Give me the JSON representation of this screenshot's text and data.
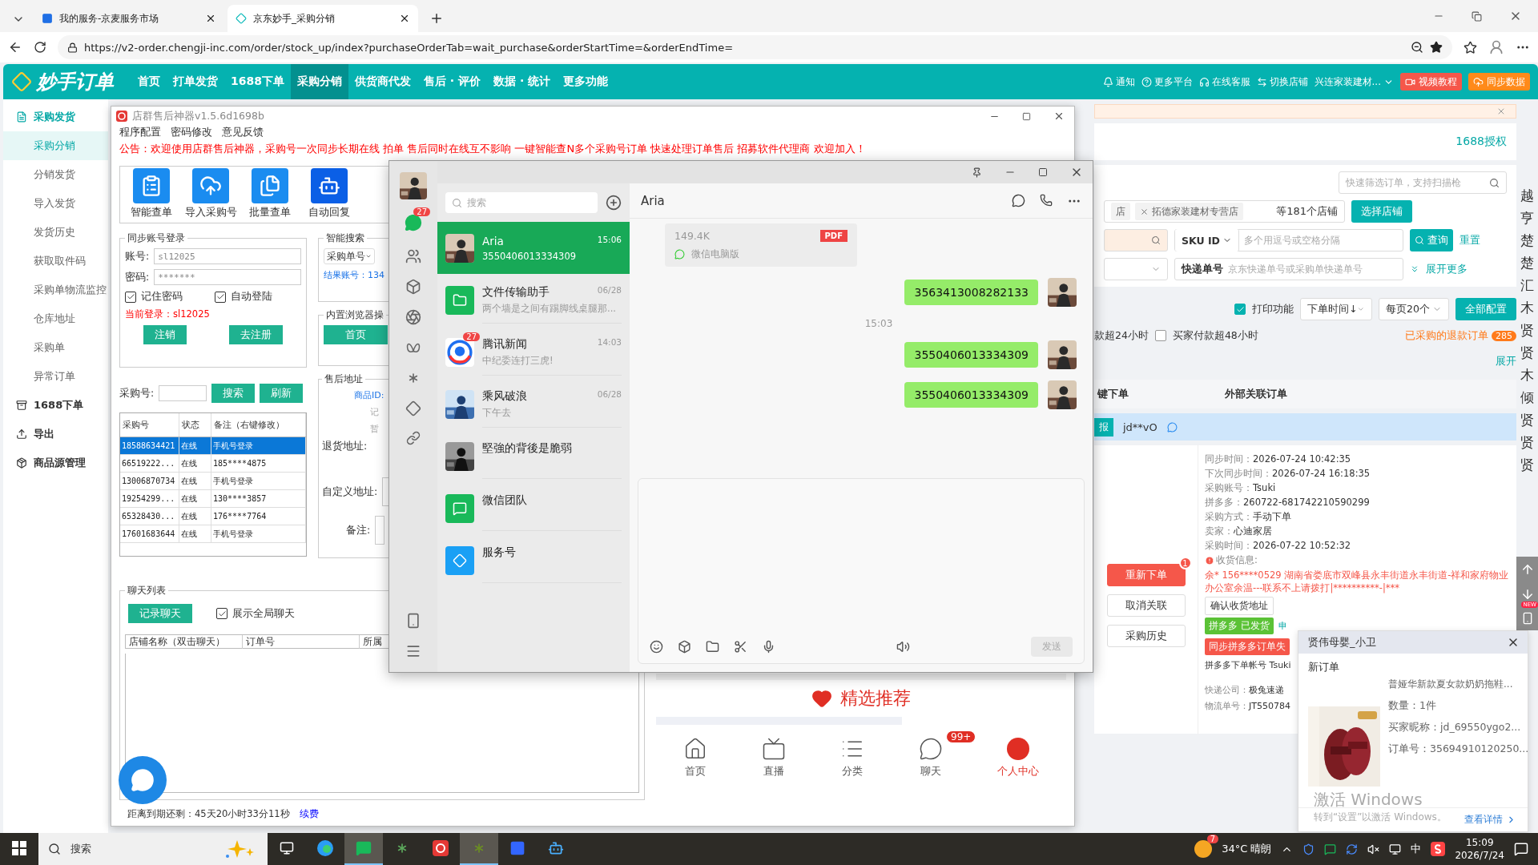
{
  "browser": {
    "tabs": [
      {
        "title": "我的服务-京麦服务市场",
        "selected": false
      },
      {
        "title": "京东妙手_采购分销",
        "selected": true
      }
    ],
    "url": "https://v2-order.chengji-inc.com/order/stock_up/index?purchaseOrderTab=wait_purchase&orderStartTime=&orderEndTime="
  },
  "app": {
    "logo": "妙手订单",
    "nav": [
      {
        "label": "首页",
        "selected": false
      },
      {
        "label": "打单发货",
        "selected": false
      },
      {
        "label": "1688下单",
        "selected": false
      },
      {
        "label": "采购分销",
        "selected": true
      },
      {
        "label": "供货商代发",
        "selected": false
      },
      {
        "label": "售后 · 评价",
        "selected": false
      },
      {
        "label": "数据 · 统计",
        "selected": false
      },
      {
        "label": "更多功能",
        "selected": false
      }
    ],
    "header_links": [
      "通知",
      "更多平台",
      "在线客服",
      "切换店铺"
    ],
    "store": "兴连家装建材...",
    "video_button": "视频教程",
    "sync_button": "同步数据"
  },
  "sidebar": [
    {
      "label": "采购发货",
      "children": [
        {
          "label": "采购分销",
          "selected": true
        },
        {
          "label": "分销发货",
          "selected": false
        },
        {
          "label": "导入发货",
          "selected": false
        },
        {
          "label": "发货历史",
          "selected": false
        },
        {
          "label": "获取取件码",
          "selected": false
        },
        {
          "label": "采购单物流监控",
          "selected": false
        },
        {
          "label": "仓库地址",
          "selected": false
        },
        {
          "label": "采购单",
          "selected": false
        },
        {
          "label": "异常订单",
          "selected": false
        }
      ]
    },
    {
      "label": "1688下单"
    },
    {
      "label": "导出"
    },
    {
      "label": "商品源管理"
    }
  ],
  "orders": {
    "auth_link": "1688授权",
    "quick_search": {
      "placeholder": "快速筛选订单，支持扫描枪"
    },
    "shop_tags": [
      {
        "label": "店",
        "removable": false
      },
      {
        "label": "拓德家装建材专营店",
        "removable": true
      }
    ],
    "shop_count": "等181个店铺",
    "select_shop": "选择店铺",
    "sku_select": "SKU ID",
    "sku_input": {
      "placeholder": "多个用逗号或空格分隔"
    },
    "query": "查询",
    "reset": "重置",
    "express_label": "快递单号",
    "express_input": {
      "placeholder": "京东快递单号或采购单快递单号"
    },
    "more": "展开更多",
    "print": {
      "label": "打印功能",
      "checked": true
    },
    "sort": "下单时间↓",
    "page_size": "每页20个",
    "config": "全部配置",
    "filters": [
      {
        "label": "款超24小时",
        "kind": "text"
      },
      {
        "label": "买家付款超48小时",
        "kind": "checkbox",
        "checked": false
      }
    ],
    "refund": {
      "label": "已采购的退款订单",
      "count": "285"
    },
    "expand": "展开",
    "columns": [
      "键下单",
      "外部关联订单"
    ],
    "order": {
      "tag": "报",
      "buyer": "jd**vO",
      "actions": [
        {
          "label": "重新下单",
          "kind": "primary",
          "badge": "1"
        },
        {
          "label": "取消关联",
          "kind": "plain"
        },
        {
          "label": "采购历史",
          "kind": "plain"
        }
      ],
      "details": [
        {
          "label": "同步时间：",
          "value": "2026-07-24 10:42:35"
        },
        {
          "label": "下次同步时间：",
          "value": "2026-07-24 16:18:35"
        },
        {
          "label": "采购账号：",
          "value": "Tsuki"
        },
        {
          "label": "拼多多：",
          "value": "260722-681742210590299"
        },
        {
          "label": "采购方式：",
          "value": "手动下单"
        },
        {
          "label": "卖家：",
          "value": "心迪家居"
        },
        {
          "label": "采购时间：",
          "value": "2026-07-22 10:52:32"
        }
      ],
      "receiver_label": "收货信息:",
      "address": "余* 156****0529 湖南省娄底市双峰县永丰街道永丰街道-祥和家府物业办公室余温---联系不上请拨打|**********-|***",
      "confirm_address": "确认收货地址",
      "shipped_tag": "拼多多 已发货",
      "apply_link": "申",
      "sync_fail": "同步拼多多订单失",
      "pdd_account": "拼多多下单帐号 Tsuki",
      "logistics": [
        {
          "label": "快递公司：",
          "value": "极兔速递"
        },
        {
          "label": "物流单号：",
          "value": "JT550784"
        }
      ]
    },
    "side_list": [
      "越",
      "亨",
      "楚",
      "楚",
      "汇",
      "木",
      "贤",
      "贤",
      "木",
      "倾",
      "贤",
      "贤",
      "贤"
    ],
    "new_badge": "NEW"
  },
  "tool": {
    "title": "店群售后神器v1.5.6d1698b",
    "menu": [
      "程序配置",
      "密码修改",
      "意见反馈"
    ],
    "notice": "公告：欢迎使用店群售后神器，采购号一次同步长期在线   拍单   售后同时在线互不影响   一键智能查N多个采购号订单   快速处理订单售后   招募软件代理商   欢迎加入！",
    "tools": [
      "智能查单",
      "导入采购号",
      "批量查单",
      "自动回复"
    ],
    "login": {
      "title": "同步账号登录",
      "account_label": "账号:",
      "account": "sl12025",
      "password_label": "密码:",
      "password": "*******",
      "remember": {
        "label": "记住密码",
        "checked": true
      },
      "auto_login": {
        "label": "自动登陆",
        "checked": true
      },
      "current": "当前登录：sl12025",
      "logout": "注销",
      "register": "去注册"
    },
    "search": {
      "label": "采购号:",
      "search": "搜索",
      "refresh": "刷新"
    },
    "accounts": {
      "columns": [
        "采购号",
        "状态",
        "备注（右键修改）"
      ],
      "rows": [
        {
          "cells": [
            "18588634421",
            "在线",
            "手机号登录"
          ],
          "selected": true
        },
        {
          "cells": [
            "66519222...",
            "在线",
            "185****4875"
          ],
          "selected": false
        },
        {
          "cells": [
            "13006870734",
            "在线",
            "手机号登录"
          ],
          "selected": false
        },
        {
          "cells": [
            "19254299...",
            "在线",
            "130****3857"
          ],
          "selected": false
        },
        {
          "cells": [
            "65328430...",
            "在线",
            "176****7764"
          ],
          "selected": false
        },
        {
          "cells": [
            "17601683644",
            "在线",
            "手机号登录"
          ],
          "selected": false
        }
      ]
    },
    "smart_search": {
      "title": "智能搜索",
      "field": "采购单号",
      "result": "结果账号：134"
    },
    "browser_ops": {
      "title": "内置浏览器操",
      "home": "首页"
    },
    "address": {
      "title": "售后地址",
      "product_id": "商品ID:",
      "fragment_1": "记",
      "fragment_2": "暂",
      "return_label": "退货地址:",
      "custom_label": "自定义地址:",
      "note_label": "备注:"
    },
    "chat_list": {
      "title": "聊天列表",
      "record": "记录聊天",
      "show_all": {
        "label": "展示全局聊天",
        "checked": true
      },
      "columns": [
        "店铺名称（双击聊天）",
        "订单号",
        "所属"
      ]
    },
    "mobile": {
      "featured": "精选推荐",
      "tabs": [
        {
          "label": "首页",
          "selected": false
        },
        {
          "label": "直播",
          "selected": false
        },
        {
          "label": "分类",
          "selected": false
        },
        {
          "label": "聊天",
          "selected": false,
          "badge": "99+"
        },
        {
          "label": "个人中心",
          "selected": true
        }
      ]
    },
    "expiry": "距离到期还剩：45天20小时33分11秒",
    "renew": "续费"
  },
  "wechat": {
    "rail_badge": "27",
    "search": {
      "placeholder": "搜索"
    },
    "conversations": [
      {
        "name": "Aria",
        "time": "15:06",
        "preview": "3550406013334309",
        "selected": true
      },
      {
        "name": "文件传输助手",
        "time": "06/28",
        "preview": "两个墙是之间有踢脚线桌腿那...",
        "kind": "file",
        "selected": false
      },
      {
        "name": "腾讯新闻",
        "time": "14:03",
        "preview": "中纪委连打三虎!",
        "kind": "news",
        "badge": "27",
        "selected": false
      },
      {
        "name": "乘风破浪",
        "time": "06/28",
        "preview": "下午去",
        "kind": "wave",
        "selected": false
      },
      {
        "name": "堅強的背後是脆弱",
        "selected": false
      },
      {
        "name": "微信团队",
        "kind": "wechat",
        "selected": false
      },
      {
        "name": "服务号",
        "kind": "service",
        "selected": false
      }
    ],
    "chat_title": "Aria",
    "messages": [
      {
        "kind": "file",
        "file_type": "PDF",
        "size": "149.4K",
        "source": "微信电脑版"
      },
      {
        "kind": "text",
        "text": "3563413008282133"
      },
      {
        "kind": "time",
        "text": "15:03"
      },
      {
        "kind": "text",
        "text": "3550406013334309"
      },
      {
        "kind": "text",
        "text": "3550406013334309"
      }
    ],
    "send": "发送"
  },
  "popup": {
    "title": "贤伟母婴_小卫",
    "heading": "新订单",
    "product": "普娅华新款夏女款奶奶拖鞋...",
    "lines": [
      "数量：1件",
      "买家昵称：jd_69550ygo2...",
      "订单号：35694910120250..."
    ],
    "details_link": "查看详情"
  },
  "activation": {
    "title": "激活 Windows",
    "hint": "转到“设置”以激活 Windows。"
  },
  "taskbar": {
    "search": "搜索",
    "ime_logo": true,
    "apps": [
      {
        "selected": false
      },
      {
        "selected": false
      },
      {
        "selected": true
      },
      {
        "selected": false
      },
      {
        "selected": false
      },
      {
        "selected": true
      },
      {
        "selected": false
      },
      {
        "selected": false
      }
    ],
    "weather_badge": "7",
    "weather": "34°C  晴朗",
    "ime": "中",
    "time": "15:09",
    "date": "2026/7/24"
  }
}
